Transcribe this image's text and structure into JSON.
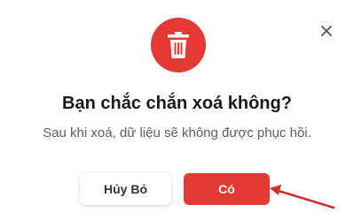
{
  "dialog": {
    "title": "Bạn chắc chắn xoá không?",
    "message": "Sau khi xoá, dữ liệu sẽ không được phục hồi.",
    "icon": "trash-icon",
    "close_icon": "close-icon",
    "cancel_label": "Hủy Bỏ",
    "confirm_label": "Có"
  },
  "colors": {
    "accent": "#e53935",
    "title": "#1a1a1a",
    "message": "#5f5f5f"
  }
}
